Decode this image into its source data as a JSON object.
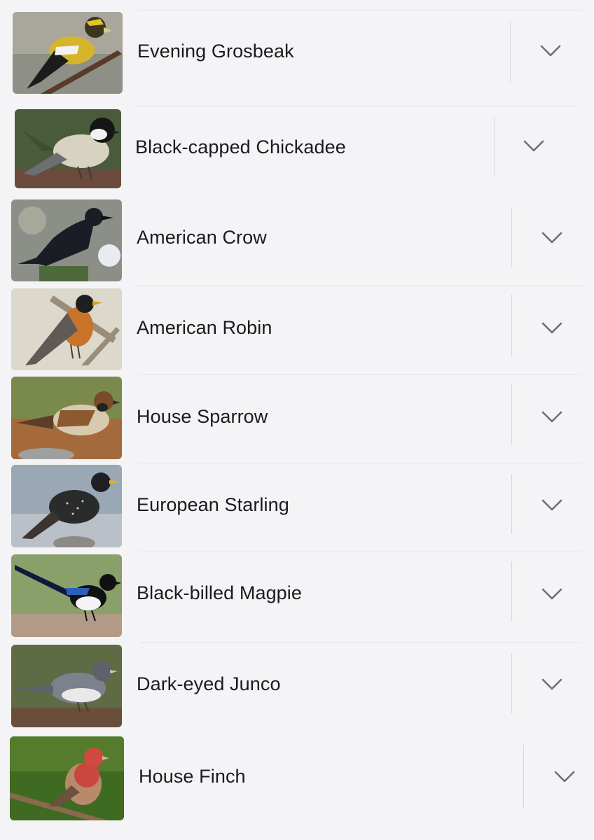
{
  "birds": [
    {
      "name": "Evening Grosbeak",
      "image": "evening-grosbeak-photo"
    },
    {
      "name": "Black-capped Chickadee",
      "image": "black-capped-chickadee-photo"
    },
    {
      "name": "American Crow",
      "image": "american-crow-photo"
    },
    {
      "name": "American Robin",
      "image": "american-robin-photo"
    },
    {
      "name": "House Sparrow",
      "image": "house-sparrow-photo"
    },
    {
      "name": "European Starling",
      "image": "european-starling-photo"
    },
    {
      "name": "Black-billed Magpie",
      "image": "black-billed-magpie-photo"
    },
    {
      "name": "Dark-eyed Junco",
      "image": "dark-eyed-junco-photo"
    },
    {
      "name": "House Finch",
      "image": "house-finch-photo"
    }
  ],
  "expand_icon": "chevron-down-icon"
}
